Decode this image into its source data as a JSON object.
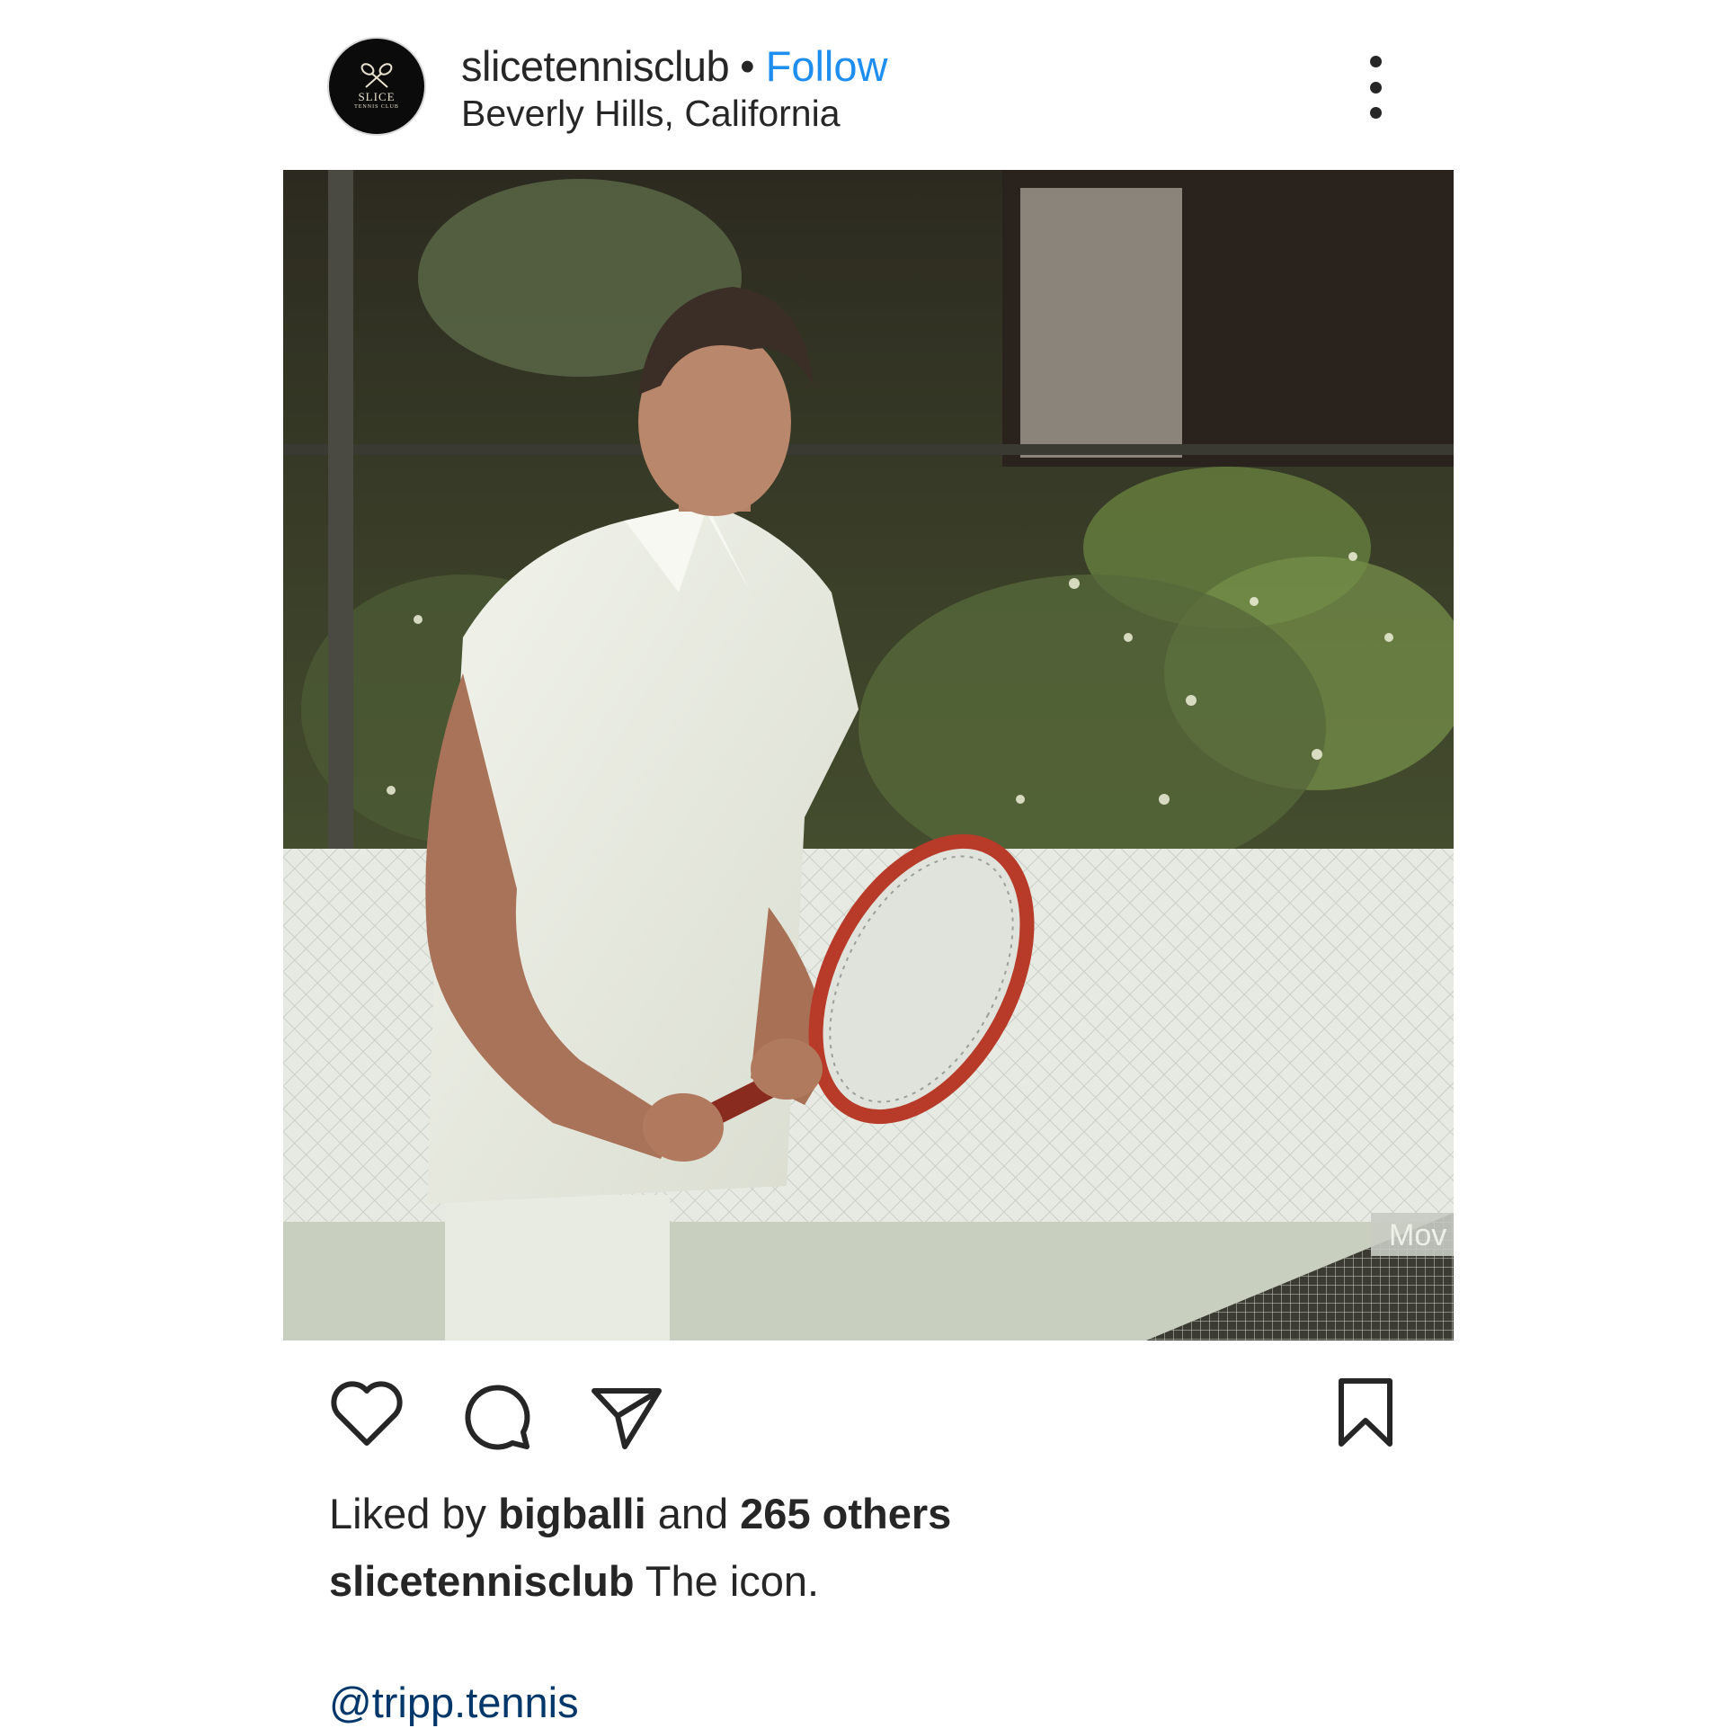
{
  "post": {
    "username": "slicetennisclub",
    "separator": "•",
    "follow_label": "Follow",
    "location": "Beverly Hills, California",
    "avatar": {
      "line1": "SLICE",
      "line2": "TENNIS CLUB"
    },
    "image_watermark": "Mov",
    "likes": {
      "prefix": "Liked by",
      "user": "bigballi",
      "conjunction": "and",
      "others": "265 others"
    },
    "caption": {
      "username": "slicetennisclub",
      "text": "The icon."
    },
    "mention": "@tripp.tennis"
  },
  "icons": {
    "more": "more-vertical-icon",
    "like": "heart-icon",
    "comment": "comment-bubble-icon",
    "share": "paper-plane-icon",
    "save": "bookmark-icon"
  },
  "colors": {
    "follow": "#1f8ef1",
    "mention": "#00376b",
    "text": "#262626"
  }
}
